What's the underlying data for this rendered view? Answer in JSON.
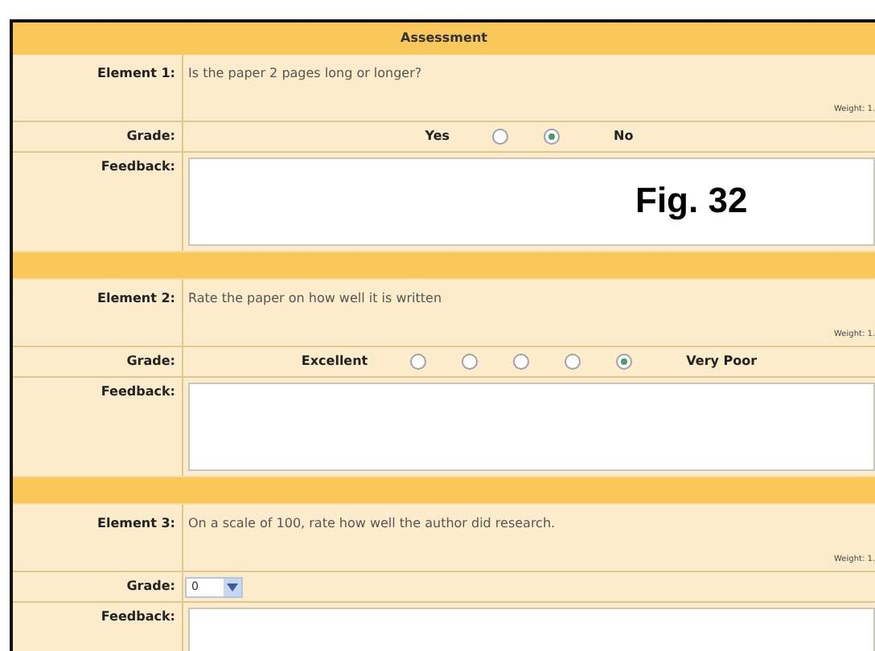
{
  "title": "Assessment",
  "elements": [
    {
      "label": "Element 1:",
      "question": "Is the paper 2 pages long or longer?",
      "weight": "Weight: 1.",
      "grade_label": "Grade:",
      "kind": "radio",
      "low_label": "Yes",
      "high_label": "No",
      "options": [
        {
          "selected": false
        },
        {
          "selected": true
        }
      ],
      "feedback_label": "Feedback:"
    },
    {
      "label": "Element 2:",
      "question": "Rate the paper on how well it is written",
      "weight": "Weight: 1.",
      "grade_label": "Grade:",
      "kind": "radio",
      "low_label": "Excellent",
      "high_label": "Very Poor",
      "options": [
        {
          "selected": false
        },
        {
          "selected": false
        },
        {
          "selected": false
        },
        {
          "selected": false
        },
        {
          "selected": true
        }
      ],
      "feedback_label": "Feedback:"
    },
    {
      "label": "Element 3:",
      "question": "On a scale of 100, rate how well the author did research.",
      "weight": "Weight: 1.",
      "grade_label": "Grade:",
      "kind": "select",
      "value": "0",
      "feedback_label": "Feedback:"
    }
  ],
  "figure_label": "Fig. 32"
}
